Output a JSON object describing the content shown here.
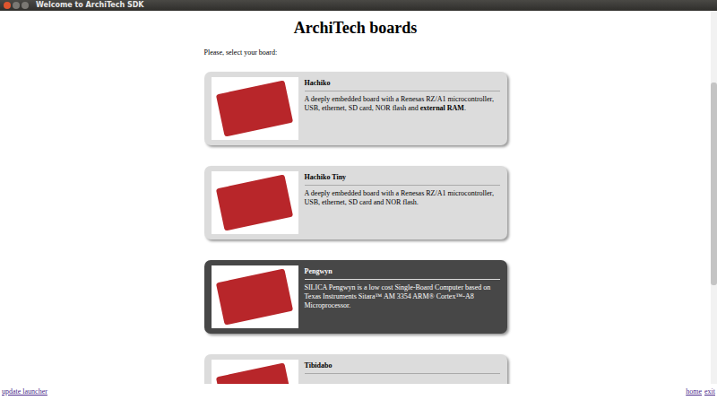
{
  "window": {
    "title": "Welcome to ArchiTech SDK"
  },
  "heading": "ArchiTech boards",
  "prompt": "Please, select your board:",
  "boards": [
    {
      "name": "Hachiko",
      "selected": false,
      "description": [
        {
          "text": "A deeply embedded board with a Renesas RZ/A1 microcontroller, USB, ethernet, SD card, NOR flash and ",
          "bold": false
        },
        {
          "text": "external RAM",
          "bold": true
        },
        {
          "text": ".",
          "bold": false
        }
      ]
    },
    {
      "name": "Hachiko Tiny",
      "selected": false,
      "description": [
        {
          "text": "A deeply embedded board with a Renesas RZ/A1 microcontroller, USB, ethernet, SD card and NOR flash.",
          "bold": false
        }
      ]
    },
    {
      "name": "Pengwyn",
      "selected": true,
      "description": [
        {
          "text": "SILICA Pengwyn is a low cost Single-Board Computer based on Texas Instruments Sitara™ AM 3354 ARM® Cortex™-A8 Microprocessor.",
          "bold": false
        }
      ]
    },
    {
      "name": "Tibidabo",
      "selected": false,
      "description": []
    }
  ],
  "footer": {
    "left": [
      "update launcher"
    ],
    "right": [
      "home",
      "exit"
    ]
  }
}
